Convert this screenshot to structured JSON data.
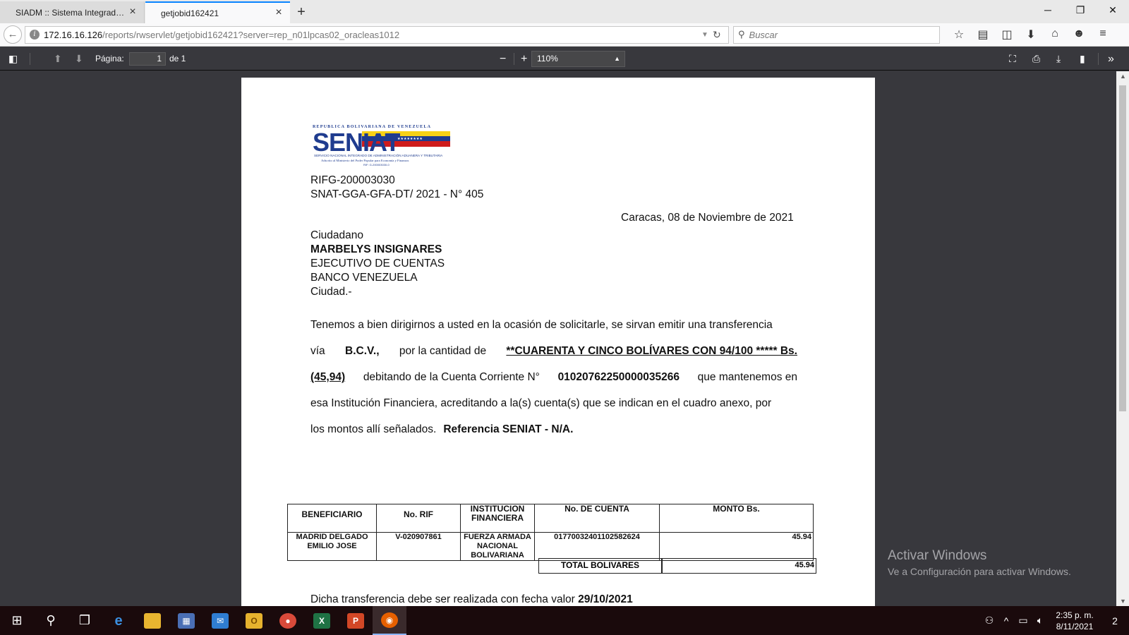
{
  "browser": {
    "tabs": [
      {
        "title": "SIADM :: Sistema Integrado de..."
      },
      {
        "title": "getjobid162421"
      }
    ],
    "new_tab": "+",
    "url_host": "172.16.16.126",
    "url_path": "/reports/rwservlet/getjobid162421?server=rep_n01lpcas02_oracleas1012",
    "search_placeholder": "Buscar"
  },
  "pdf_toolbar": {
    "page_label": "Página:",
    "page_value": "1",
    "page_total": "de 1",
    "zoom_value": "110%",
    "zoom_minus": "−",
    "zoom_plus": "+"
  },
  "letter": {
    "org_header": "REPUBLICA BOLIVARIANA DE VENEZUELA",
    "logo_text": "SENIAT",
    "logo_sub1": "SERVICIO NACIONAL INTEGRADO DE ADMINISTRACIÓN ADUANERA Y TRIBUTARIA",
    "logo_sub2": "Adscrito al Ministerio del Poder Popular para Economía y Finanzas",
    "logo_sub3": "RIF: G-200003030-0",
    "rif": "RIFG-200003030",
    "reference": "SNAT-GGA-GFA-DT/ 2021 - N° 405",
    "place_date": "Caracas, 08 de Noviembre de 2021",
    "salutation": "Ciudadano",
    "recipient_name": "MARBELYS INSIGNARES",
    "recipient_title": "EJECUTIVO DE CUENTAS",
    "recipient_bank": "BANCO VENEZUELA",
    "recipient_city": "Ciudad.-",
    "body": {
      "l1": "Tenemos a bien dirigirnos a usted en la ocasión de solicitarle,  se sirvan emitir una transferencia",
      "l2a": "vía",
      "l2b": "B.C.V.,",
      "l2c": "por la cantidad  de",
      "l2d": "**CUARENTA Y CINCO BOLÍVARES CON 94/100 ***** Bs.",
      "l3a": "(45,94)",
      "l3b": "debitando de  la  Cuenta  Corriente N°",
      "l3c": "01020762250000035266",
      "l3d": "que  mantenemos  en",
      "l4": "esa  Institución Financiera, acreditando a la(s) cuenta(s) que se indican en el cuadro anexo, por",
      "l5a": "los  montos allí señalados.",
      "l5b": "Referencia SENIAT - N/A."
    },
    "table": {
      "headers": [
        "BENEFICIARIO",
        "No. RIF",
        "INSTITUCION FINANCIERA",
        "No. DE CUENTA",
        "MONTO Bs."
      ],
      "row": {
        "beneficiario": "MADRID DELGADO EMILIO JOSE",
        "rif": "V-020907861",
        "institucion": "FUERZA ARMADA NACIONAL BOLIVARIANA",
        "cuenta": "01770032401102582624",
        "monto": "45.94"
      },
      "total_label": "TOTAL BOLIVARES",
      "total_value": "45.94"
    },
    "closing_a": "Dicha transferencia debe ser realizada con fecha valor",
    "closing_b": "29/10/2021"
  },
  "watermark": {
    "line1": "Activar Windows",
    "line2": "Ve a Configuración para activar Windows."
  },
  "taskbar": {
    "time": "2:35 p. m.",
    "date": "8/11/2021",
    "notif_count": "2"
  },
  "colors": {
    "pdf_bg": "#38383d",
    "tab_accent": "#0a84ff",
    "seniat_blue": "#1f3c8f",
    "flag_yellow": "#f7d117",
    "flag_red": "#cf1c1c"
  }
}
